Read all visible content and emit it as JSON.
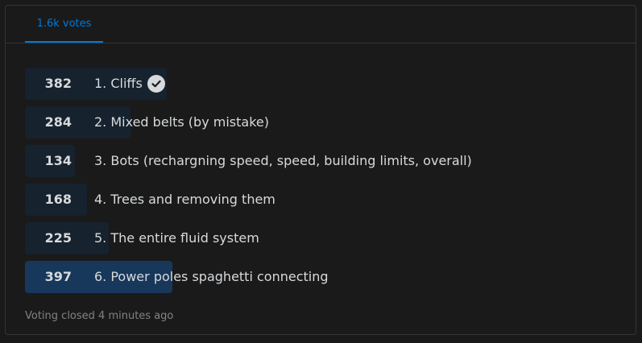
{
  "tab": {
    "label": "1.6k votes"
  },
  "options": [
    {
      "count": "382",
      "label": "1. Cliffs",
      "votes": 382,
      "chosen": true,
      "winner": false
    },
    {
      "count": "284",
      "label": "2. Mixed belts (by mistake)",
      "votes": 284,
      "chosen": false,
      "winner": false
    },
    {
      "count": "134",
      "label": "3. Bots (rechargning speed, speed, building limits, overall)",
      "votes": 134,
      "chosen": false,
      "winner": false
    },
    {
      "count": "168",
      "label": "4. Trees and removing them",
      "votes": 168,
      "chosen": false,
      "winner": false
    },
    {
      "count": "225",
      "label": "5. The entire fluid system",
      "votes": 225,
      "chosen": false,
      "winner": false
    },
    {
      "count": "397",
      "label": "6. Power poles spaghetti connecting",
      "votes": 397,
      "chosen": false,
      "winner": true
    }
  ],
  "footer": {
    "status": "Voting closed 4 minutes ago"
  },
  "colors": {
    "accent": "#0079d3",
    "bar": "#16222e",
    "winner_bar": "#17385a",
    "text": "#d7dadc",
    "muted": "#818384"
  },
  "icons": {
    "chosen": "check-circle-icon"
  }
}
